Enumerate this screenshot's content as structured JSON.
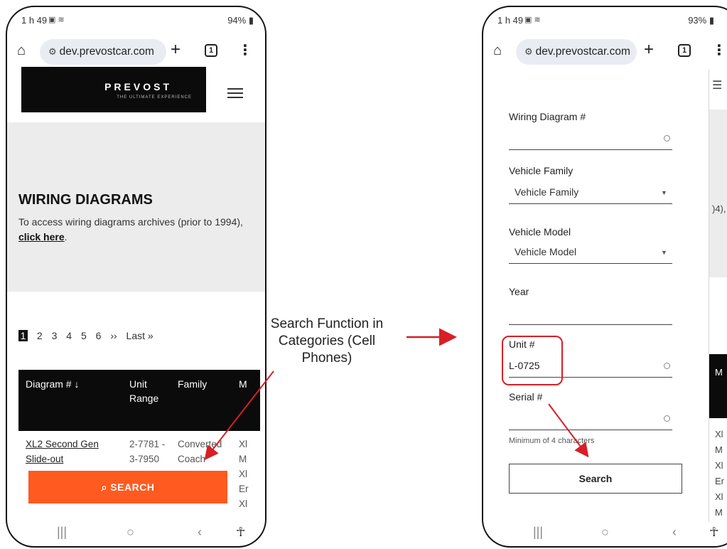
{
  "phone1": {
    "status": {
      "time": "1 h 49",
      "battery": "94%"
    },
    "url": "dev.prevostcar.com",
    "tab_count": "1",
    "logo": {
      "brand": "PREVOST",
      "tagline": "THE ULTIMATE EXPERIENCE"
    },
    "hero": {
      "title": "WIRING DIAGRAMS",
      "description": "To access wiring diagrams archives (prior to 1994),",
      "link_text": "click here",
      "link_suffix": "."
    },
    "pagination": {
      "pages": [
        "1",
        "2",
        "3",
        "4",
        "5",
        "6"
      ],
      "next": "››",
      "last": "Last »"
    },
    "table": {
      "headers": {
        "diagram": "Diagram # ↓",
        "unit": "Unit Range",
        "family": "Family",
        "model": "M"
      },
      "row": {
        "diagram": "XL2 Second Gen Slide-out",
        "unit": "2-7781 - 3-7950",
        "family": "Converted Coach",
        "model": "Xl M Xl Er Xl"
      }
    },
    "search_button": "SEARCH"
  },
  "caption": "Search Function in Categories (Cell Phones)",
  "phone2": {
    "status": {
      "time": "1 h 49",
      "battery": "93%"
    },
    "url": "dev.prevostcar.com",
    "tab_count": "1",
    "form": {
      "wiring_label": "Wiring Diagram #",
      "family_label": "Vehicle Family",
      "family_value": "Vehicle Family",
      "model_label": "Vehicle Model",
      "model_value": "Vehicle Model",
      "year_label": "Year",
      "unit_label": "Unit #",
      "unit_value": "L-0725",
      "serial_label": "Serial #",
      "hint": "Minimum of 4 characters",
      "search_label": "Search"
    },
    "behind": {
      "year_fragment": ")4),",
      "col_fragment": "M",
      "rows": [
        "Xl",
        "M",
        "Xl",
        "Er",
        "Xl",
        "M"
      ]
    }
  },
  "colors": {
    "accent": "#ff5a1f",
    "highlight": "#d81f26",
    "brand_bg": "#0b0b0b"
  }
}
